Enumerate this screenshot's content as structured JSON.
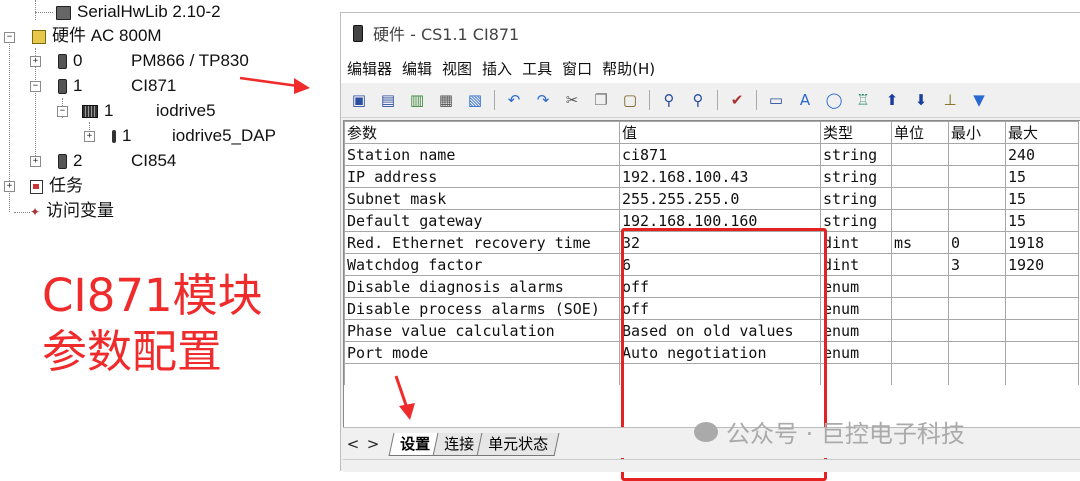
{
  "tree": {
    "lib": "SerialHwLib 2.10-2",
    "hardware": "硬件 AC 800M",
    "nodes": [
      {
        "pos": "0",
        "name": "PM866 / TP830"
      },
      {
        "pos": "1",
        "name": "CI871"
      },
      {
        "pos": "1",
        "name": "iodrive5"
      },
      {
        "pos": "1",
        "name": "iodrive5_DAP"
      },
      {
        "pos": "2",
        "name": "CI854"
      }
    ],
    "tasks": "任务",
    "access_vars": "访问变量"
  },
  "annotation": {
    "line1": "CI871模块",
    "line2": "参数配置"
  },
  "window": {
    "title": "硬件 - CS1.1  CI871",
    "menu": [
      "编辑器",
      "编辑",
      "视图",
      "插入",
      "工具",
      "窗口",
      "帮助(H)"
    ],
    "toolbar_icons": [
      "save-all-icon",
      "save-icon",
      "download-icon",
      "print-icon",
      "print-preview-icon",
      "undo-icon",
      "redo-icon",
      "cut-icon",
      "copy-icon",
      "paste-icon",
      "find-icon",
      "find-replace-icon",
      "check-icon",
      "properties-icon",
      "font-icon",
      "ellipse-icon",
      "tree-icon",
      "up-arrow-icon",
      "down-arrow-icon",
      "insert-icon",
      "filter-icon"
    ],
    "columns": [
      "参数",
      "值",
      "类型",
      "单位",
      "最小",
      "最大"
    ],
    "rows": [
      [
        "Station name",
        "ci871",
        "string",
        "",
        "",
        "240"
      ],
      [
        "IP address",
        "192.168.100.43",
        "string",
        "",
        "",
        "15"
      ],
      [
        "Subnet mask",
        "255.255.255.0",
        "string",
        "",
        "",
        "15"
      ],
      [
        "Default gateway",
        "192.168.100.160",
        "string",
        "",
        "",
        "15"
      ],
      [
        "Red. Ethernet recovery time",
        "32",
        "dint",
        "ms",
        "0",
        "1918"
      ],
      [
        "Watchdog factor",
        "6",
        "dint",
        "",
        "3",
        "1920"
      ],
      [
        "Disable diagnosis alarms",
        "off",
        "enum",
        "",
        "",
        ""
      ],
      [
        "Disable process alarms (SOE)",
        "off",
        "enum",
        "",
        "",
        ""
      ],
      [
        "Phase value calculation",
        "Based on old values",
        "enum",
        "",
        "",
        ""
      ],
      [
        "Port mode",
        "Auto negotiation",
        "enum",
        "",
        "",
        ""
      ]
    ],
    "tabs": [
      "设置",
      "连接",
      "单元状态"
    ],
    "nav": [
      "<",
      ">"
    ]
  },
  "watermark": "公众号 · 巨控电子科技",
  "colors": {
    "highlight": "#e52222",
    "annotation": "#ef2b2b"
  }
}
